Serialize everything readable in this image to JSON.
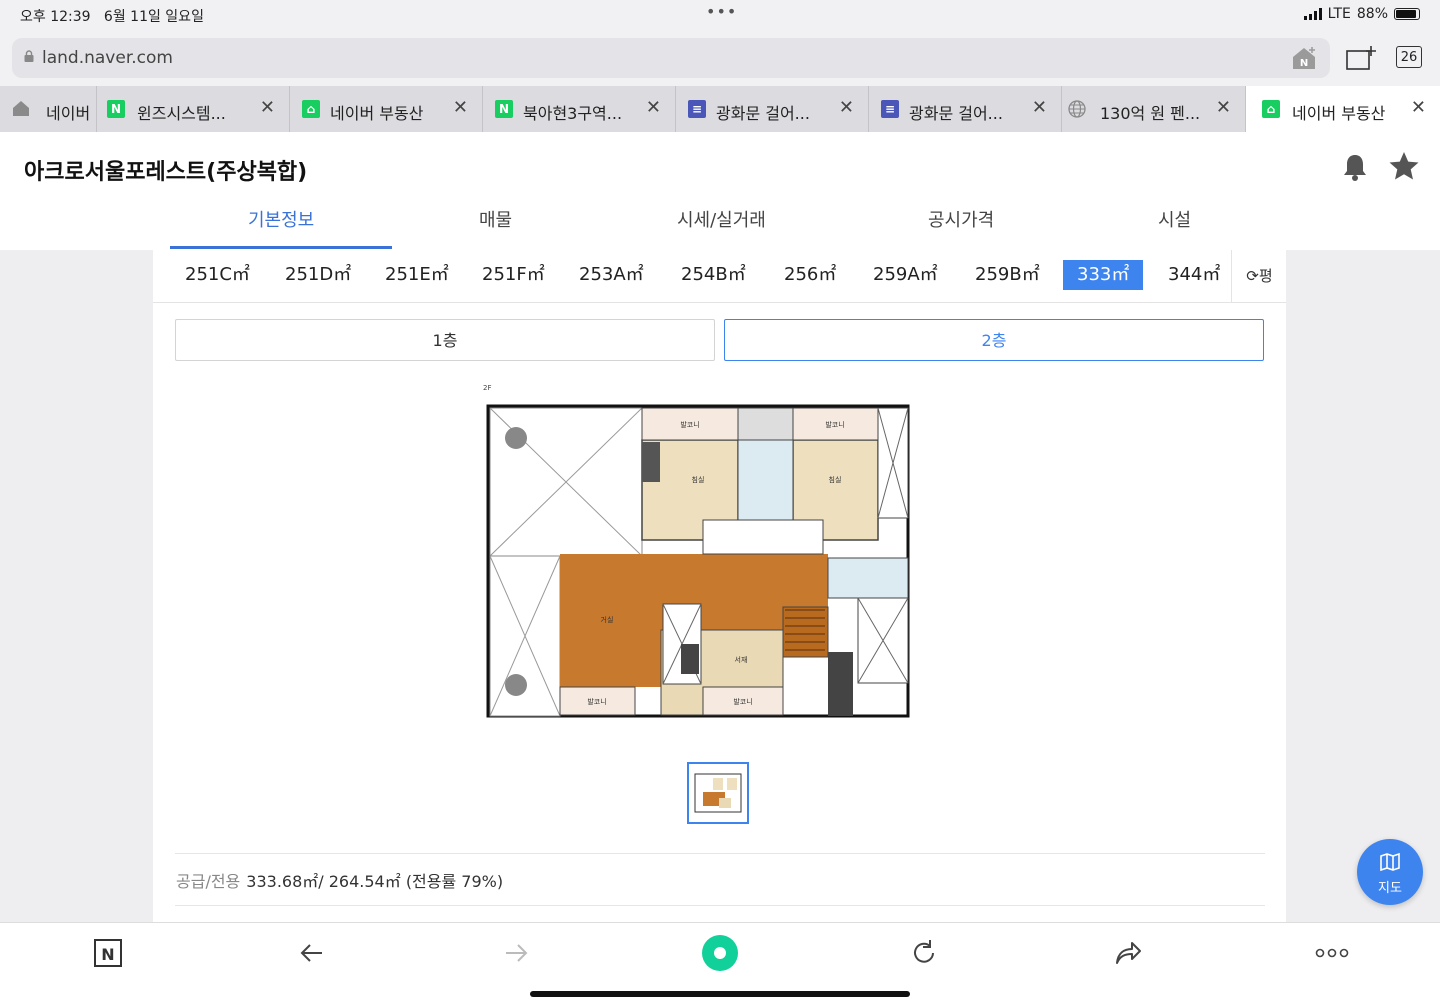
{
  "status": {
    "time": "오후 12:39",
    "date": "6월 11일 일요일",
    "network": "LTE",
    "battery": "88%"
  },
  "browser": {
    "url": "land.naver.com",
    "tab_count": "26",
    "tabs": [
      {
        "title": "네이버",
        "icon": "home-icon",
        "color": "#8a8a8a"
      },
      {
        "title": "윈즈시스템...",
        "icon": "naver-n-icon",
        "color": "#19ce60"
      },
      {
        "title": "네이버 부동산",
        "icon": "naver-land-icon",
        "color": "#19ce60"
      },
      {
        "title": "북아현3구역...",
        "icon": "naver-n-icon",
        "color": "#19ce60"
      },
      {
        "title": "광화문 걸어...",
        "icon": "document-icon",
        "color": "#4a56b8"
      },
      {
        "title": "광화문 걸어...",
        "icon": "document-icon",
        "color": "#4a56b8"
      },
      {
        "title": "130억 원 펜...",
        "icon": "globe-icon",
        "color": "#888888"
      },
      {
        "title": "네이버 부동산",
        "icon": "naver-land-icon",
        "color": "#19ce60"
      }
    ]
  },
  "page": {
    "title": "아크로서울포레스트(주상복합)",
    "nav": [
      "기본정보",
      "매물",
      "시세/실거래",
      "공시가격",
      "시설"
    ],
    "sizes": [
      "251C㎡",
      "251D㎡",
      "251E㎡",
      "251F㎡",
      "253A㎡",
      "254B㎡",
      "256㎡",
      "259A㎡",
      "259B㎡",
      "333㎡",
      "344㎡"
    ],
    "selected_size": "333㎡",
    "unit_toggle": "평",
    "floors": [
      "1층",
      "2층"
    ],
    "selected_floor": "2층",
    "plan_labels": {
      "floor": "2F",
      "bedroom": "침실",
      "balcony": "발코니",
      "living": "거실",
      "study": "서재"
    },
    "area_label": "공급/전용",
    "area_value": "333.68㎡/ 264.54㎡ (전용률 79%)",
    "map_button": "지도"
  },
  "colors": {
    "accent": "#3e84ef",
    "tab_active": "#3a72d8",
    "naver_green": "#19ce60"
  }
}
